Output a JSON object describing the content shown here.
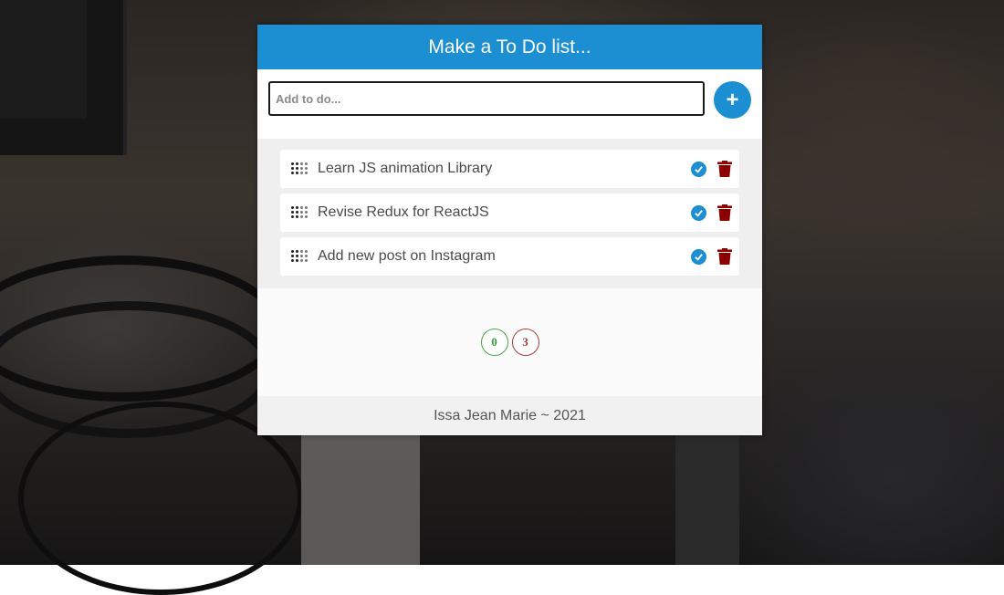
{
  "app": {
    "title": "Make a To Do list..."
  },
  "add": {
    "placeholder": "Add to do...",
    "value": "",
    "button_label": "+"
  },
  "todos": [
    {
      "text": "Learn JS animation Library"
    },
    {
      "text": "Revise Redux for ReactJS"
    },
    {
      "text": "Add new post on Instagram"
    }
  ],
  "counters": {
    "done": "0",
    "remaining": "3"
  },
  "footer": {
    "text": "Issa Jean Marie ~ 2021"
  },
  "colors": {
    "accent": "#1b8fd1",
    "delete": "#8b0000",
    "done_counter": "#3a9a3a",
    "remaining_counter": "#a53d3d"
  },
  "icons": {
    "drag": "drag-handle-icon",
    "check": "check-circle-icon",
    "delete": "trash-icon"
  }
}
